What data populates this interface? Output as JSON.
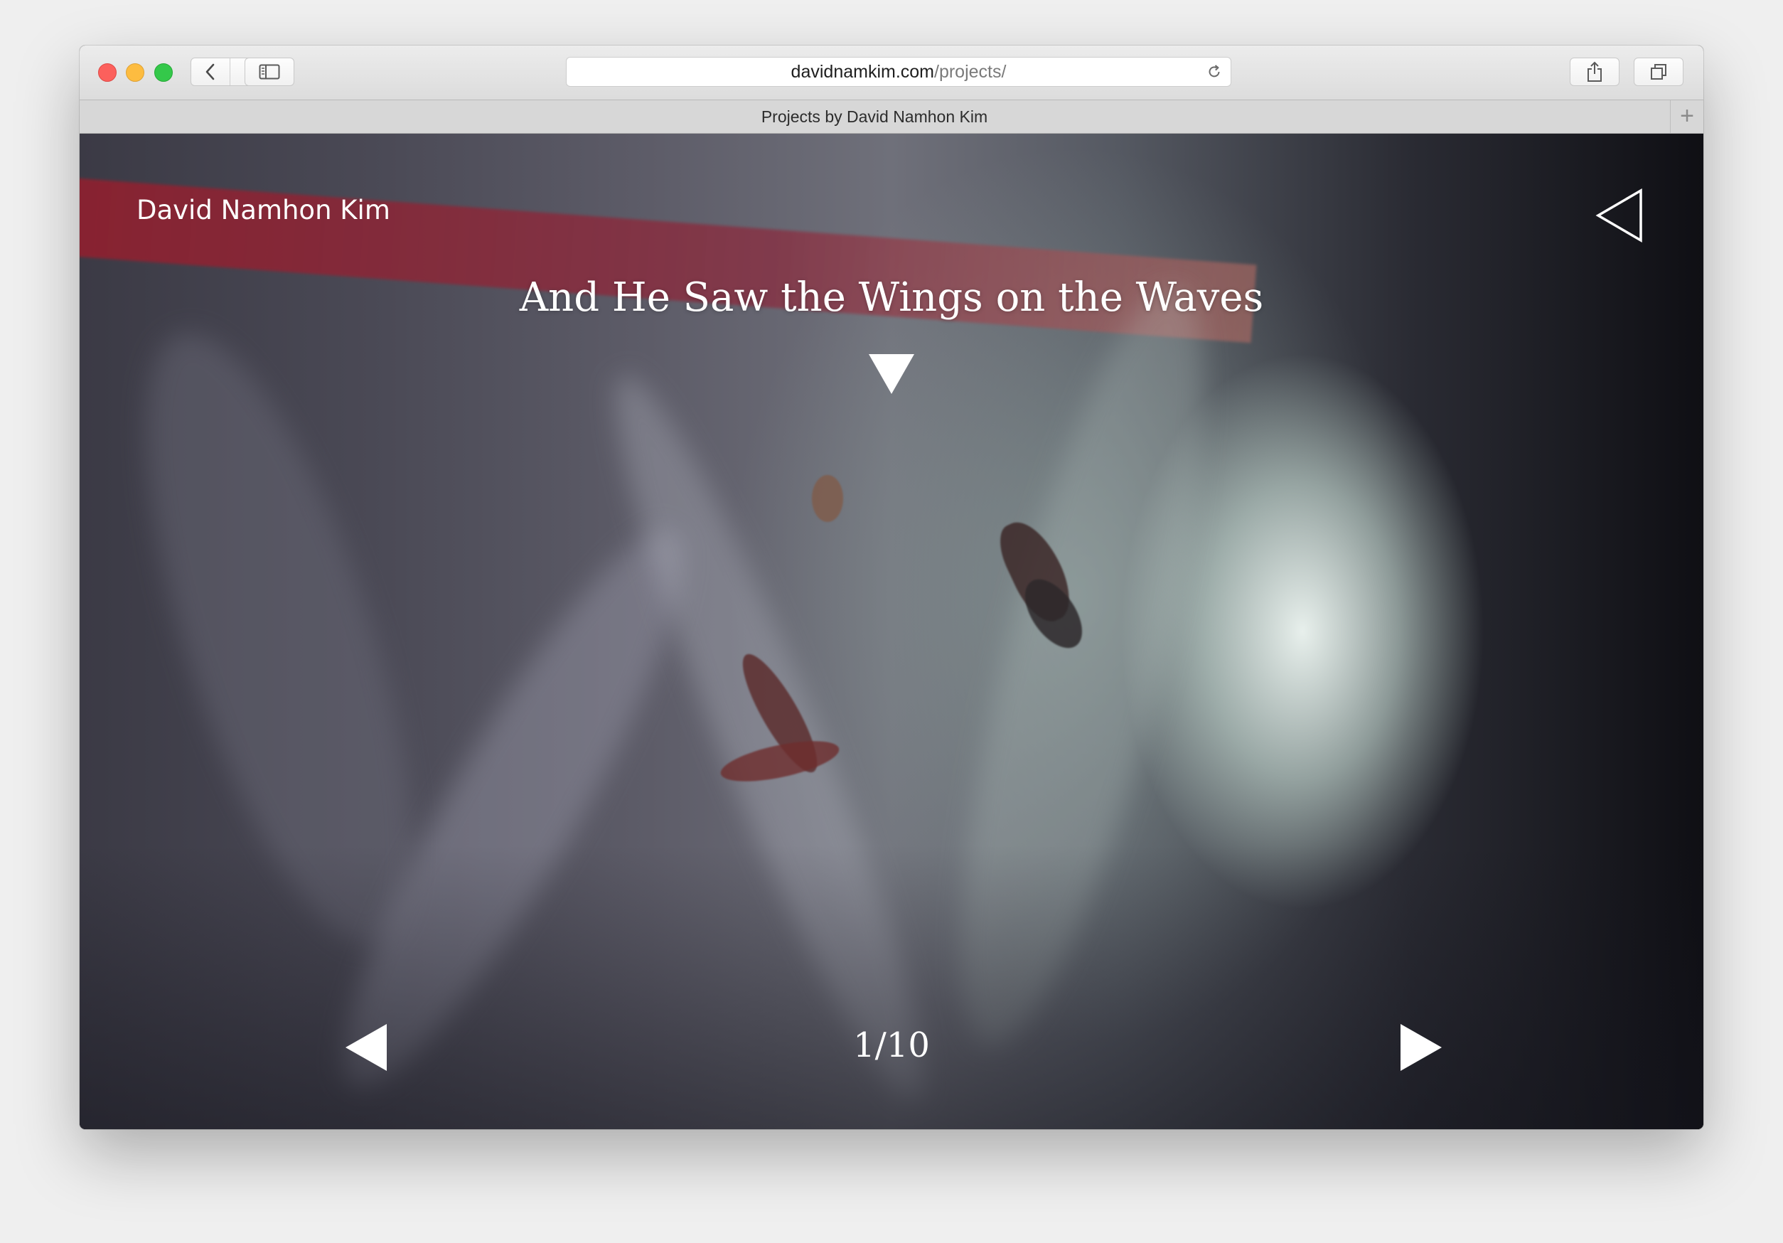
{
  "browser": {
    "url_host": "davidnamkim.com",
    "url_path": "/projects/",
    "tab_title": "Projects by David Namhon Kim",
    "new_tab_label": "+"
  },
  "site": {
    "name": "David Namhon Kim",
    "project_title": "And He Saw the Wings on the Waves",
    "slide_current": 1,
    "slide_total": 10,
    "counter_text": "1/10"
  },
  "colors": {
    "text": "#ffffff",
    "close": "#fc605c",
    "minimize": "#fdbc40",
    "maximize": "#34c84a"
  },
  "icons": {
    "menu": "left-triangle-outline-icon",
    "scroll_down": "down-triangle-icon",
    "previous": "left-triangle-icon",
    "next": "right-triangle-icon"
  }
}
